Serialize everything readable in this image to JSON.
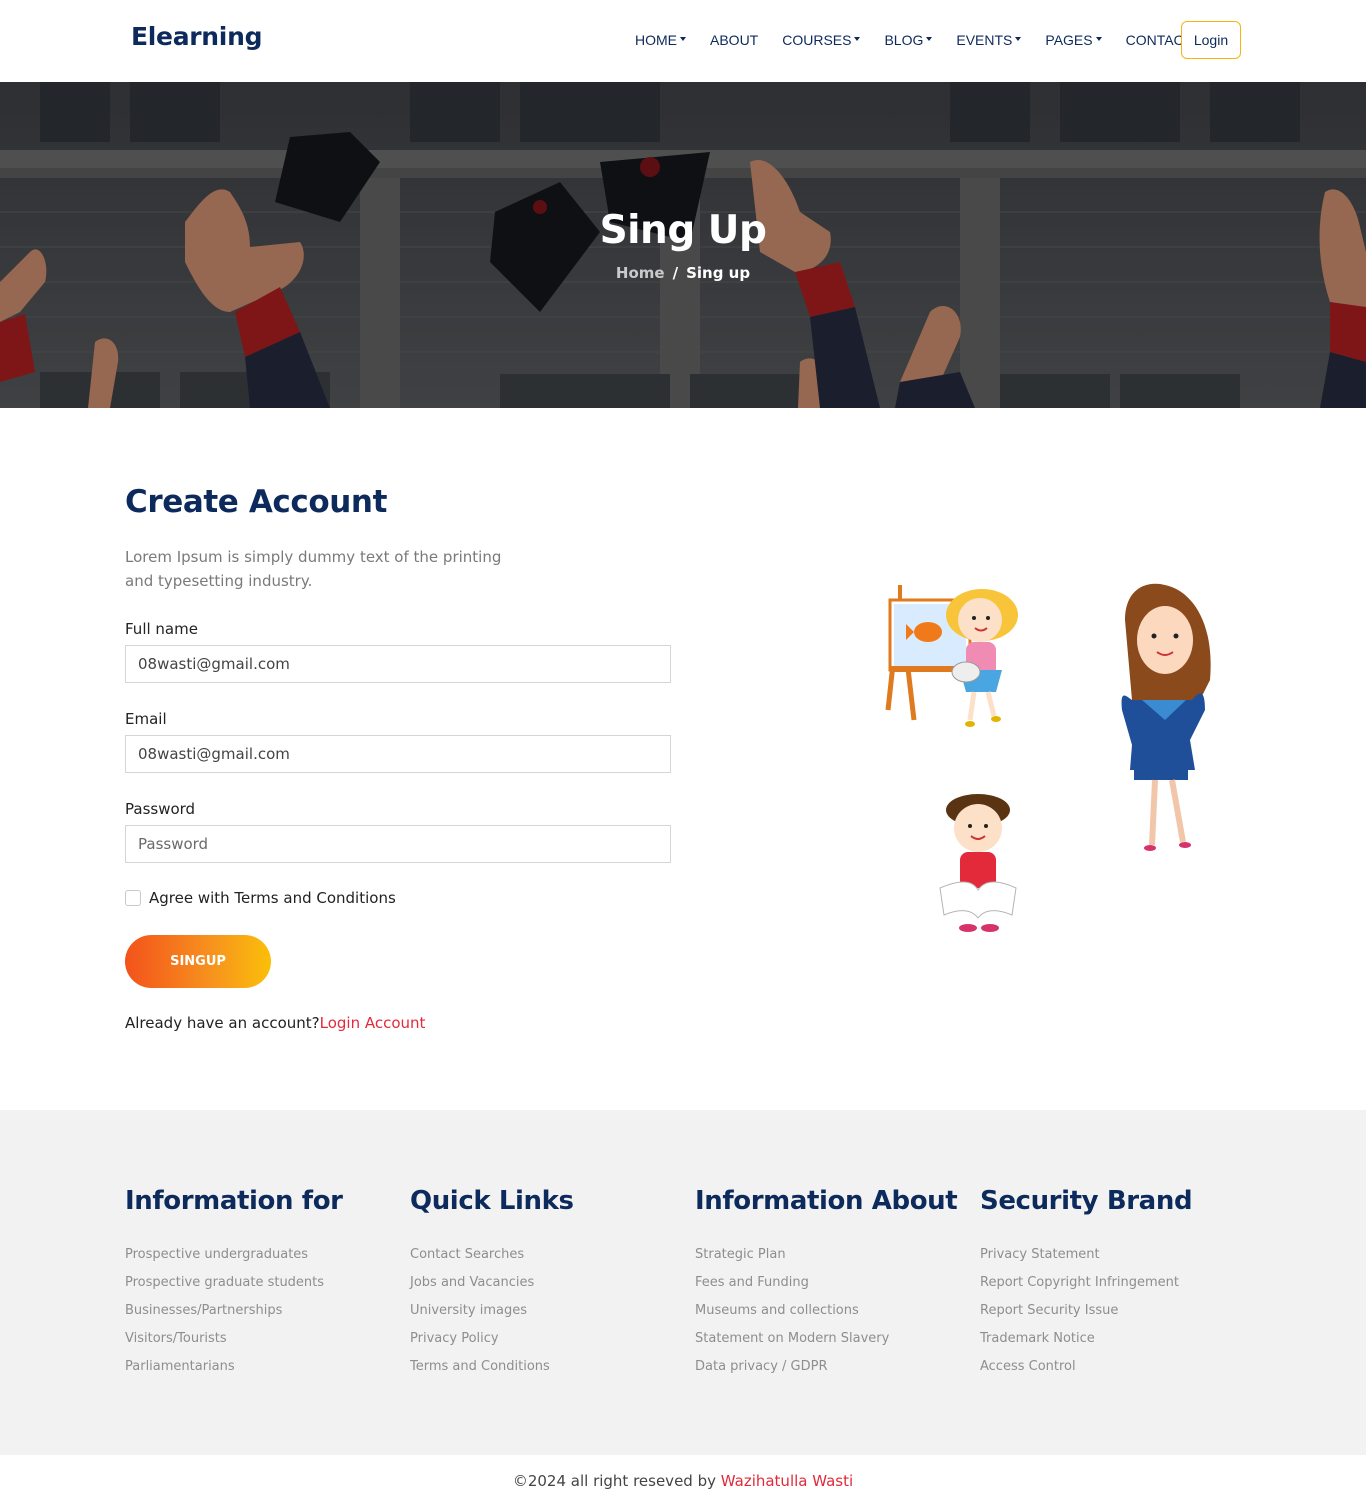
{
  "header": {
    "logo": "Elearning",
    "nav": [
      {
        "label": "HOME",
        "dropdown": true
      },
      {
        "label": "ABOUT",
        "dropdown": false
      },
      {
        "label": "COURSES",
        "dropdown": true
      },
      {
        "label": "BLOG",
        "dropdown": true
      },
      {
        "label": "EVENTS",
        "dropdown": true
      },
      {
        "label": "PAGES",
        "dropdown": true
      },
      {
        "label": "CONTACT",
        "dropdown": false
      }
    ],
    "login_label": "Login"
  },
  "hero": {
    "title": "Sing Up",
    "breadcrumb": {
      "home": "Home",
      "separator": "/",
      "current": "Sing up"
    }
  },
  "form": {
    "title": "Create Account",
    "description": "Lorem Ipsum is simply dummy text of the printing and typesetting industry.",
    "fullname_label": "Full name",
    "fullname_value": "08wasti@gmail.com",
    "email_label": "Email",
    "email_value": "08wasti@gmail.com",
    "password_label": "Password",
    "password_placeholder": "Password",
    "agree_label": "Agree with Terms and Conditions",
    "agree_checked": false,
    "submit_label": "SINGUP",
    "have_account_text": "Already have an account?",
    "login_link": "Login Account"
  },
  "footer": {
    "columns": [
      {
        "title": "Information for",
        "links": [
          "Prospective undergraduates",
          "Prospective graduate students",
          "Businesses/Partnerships",
          "Visitors/Tourists",
          "Parliamentarians"
        ]
      },
      {
        "title": "Quick Links",
        "links": [
          "Contact Searches",
          "Jobs and Vacancies",
          "University images",
          "Privacy Policy",
          "Terms and Conditions"
        ]
      },
      {
        "title": "Information About",
        "links": [
          "Strategic Plan",
          "Fees and Funding",
          "Museums and collections",
          "Statement on Modern Slavery",
          "Data privacy / GDPR"
        ]
      },
      {
        "title": "Security Brand",
        "links": [
          "Privacy Statement",
          "Report Copyright Infringement",
          "Report Security Issue",
          "Trademark Notice",
          "Access Control"
        ]
      }
    ],
    "copyright_prefix": "©2024 all right reseved by ",
    "copyright_author": "Wazihatulla Wasti"
  },
  "colors": {
    "brand_navy": "#0d2a5c",
    "accent_red": "#e22a3a",
    "login_border": "#f5b414",
    "button_gradient_start": "#f3521b",
    "button_gradient_end": "#fbbf09"
  }
}
